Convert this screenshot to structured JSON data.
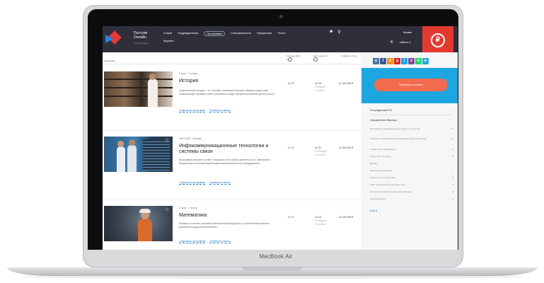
{
  "header": {
    "logo_line1": "Поступи",
    "logo_line2": "Онлайн",
    "logo_sub": "Online-Bologna",
    "nav": [
      "О вузе",
      "Подразделения",
      "Программы",
      "Специальности",
      "Профессии",
      "Тесты"
    ],
    "nav_selected": 2,
    "nav_second": "Журнал",
    "city": "Москва",
    "cabinet": "кабинет ▾",
    "badge": "₽"
  },
  "table_head": {
    "program": "Программа",
    "col1": "проходн. балл ▾",
    "col2": "мест на место",
    "col3": "стоимость в год"
  },
  "items": [
    {
      "meta": "2 вуза · 2 плана",
      "title": "История",
      "desc": "Современный историк – это человек, имеющий широкую базовую подготовку, позволяющую проявить себя в различных видах профессиональной деятельности",
      "link1": "2 варианта программы",
      "link2": "Проверить шансы",
      "score": "от 70",
      "places": "от 3.5",
      "places_sub": "3 бюджет",
      "places_sub2": "6 платно",
      "price": "от 120 000 ₽"
    },
    {
      "meta": "НИУ ВШЭ · Москва",
      "title": "Инфокоммуникационные технологии и системы связи",
      "desc": "Программа профиля готовит специалистов в сфере деятельности, связанной с внедрением и эксплуатацией инфокоммуникационного оборудования…",
      "link1": "2 варианта программы",
      "link2": "Проверить шансы",
      "score": "от 72",
      "places": "от 13",
      "places_sub": "34 бюджет",
      "places_sub2": "10 платно",
      "price": "от 240 000 ₽"
    },
    {
      "meta": "2 вуза · 2 плана",
      "title": "Математика",
      "desc": "Профиль сочетает широкий математический кругозор с углубленным знанием различных разделов математики",
      "link1": "2 варианта программы",
      "link2": "Проверить шансы",
      "score": "от 72",
      "places": "от 2.5",
      "places_sub": "16 бюджет",
      "places_sub2": "30 платно",
      "price": "от 130 000 ₽"
    }
  ],
  "sidebar": {
    "cta": "Проверить шансы",
    "filter_ege": "По предметам ЕГЭ",
    "filter_dir": "Направления обучения",
    "rows": [
      {
        "label": "Математика, информационные науки и технологии",
        "n": "14"
      },
      {
        "label": "Политика, регионоведение и международные отношения",
        "n": "11"
      },
      {
        "label": "Управление и менеджмент",
        "n": "9"
      },
      {
        "label": "Искусство и культура",
        "n": "8"
      },
      {
        "label": "Дизайн",
        "n": "7"
      },
      {
        "label": "Экономика и финансы",
        "n": "7"
      },
      {
        "label": "Филология и лингвистика",
        "n": "6"
      },
      {
        "label": "СМИ, журналистика, реклама и PR",
        "n": "5"
      },
      {
        "label": "История, археология и документоведение",
        "n": "4"
      },
      {
        "label": "Юриспруденция",
        "n": "4"
      }
    ],
    "more": "Ещё 8"
  },
  "laptop_brand": "MacBook Air"
}
